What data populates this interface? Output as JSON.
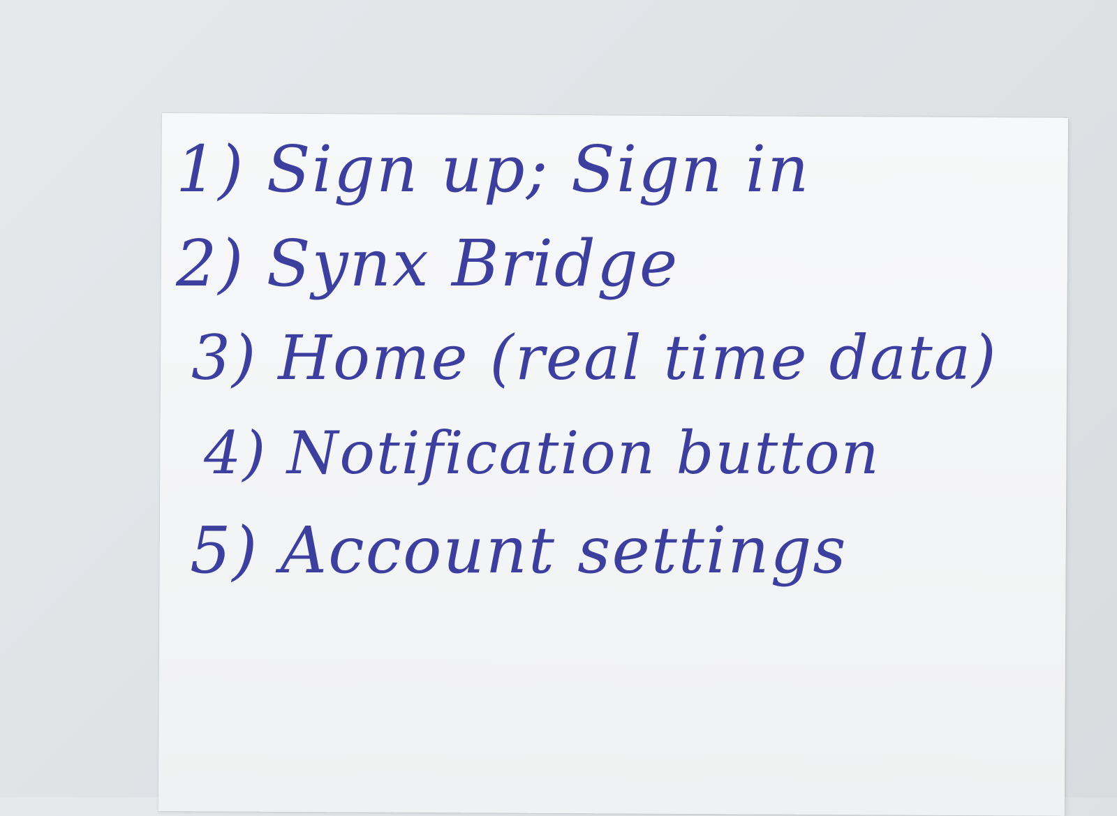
{
  "note": {
    "items": [
      "1) Sign up; Sign in",
      "2) Synx Bridge",
      "3) Home (real time data)",
      "4) Notification button",
      "5) Account settings"
    ]
  }
}
